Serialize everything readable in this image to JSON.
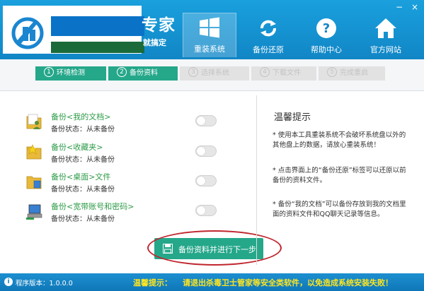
{
  "header": {
    "brand_big": "专家",
    "brand_small": "就搞定",
    "window_controls": [
      "−",
      "×"
    ],
    "nav": [
      {
        "label": "重装系统",
        "icon": "windows-logo-icon",
        "active": true
      },
      {
        "label": "备份还原",
        "icon": "refresh-icon",
        "active": false
      },
      {
        "label": "帮助中心",
        "icon": "question-icon",
        "active": false
      },
      {
        "label": "官方网站",
        "icon": "home-icon",
        "active": false
      }
    ]
  },
  "steps": [
    {
      "num": "1",
      "label": "环境检测",
      "state": "done"
    },
    {
      "num": "2",
      "label": "备份资料",
      "state": "done"
    },
    {
      "num": "3",
      "label": "选择系统",
      "state": "todo"
    },
    {
      "num": "4",
      "label": "下载文件",
      "state": "todo"
    },
    {
      "num": "5",
      "label": "完成重启",
      "state": "todo"
    }
  ],
  "backup_items": [
    {
      "title": "备份<我的文档>",
      "status": "备份状态：从未备份",
      "icon": "my-documents-folder-icon",
      "enabled": false
    },
    {
      "title": "备份<收藏夹>",
      "status": "备份状态：从未备份",
      "icon": "favorites-folder-icon",
      "enabled": false
    },
    {
      "title": "备份<桌面>文件",
      "status": "备份状态：从未备份",
      "icon": "desktop-folder-icon",
      "enabled": false
    },
    {
      "title": "备份<宽带账号和密码>",
      "status": "备份状态：从未备份",
      "icon": "network-computer-icon",
      "enabled": false
    }
  ],
  "tips": {
    "title": "温馨提示",
    "items": [
      "* 使用本工具重装系统不会破坏系统盘以外的其他盘上的数据，请放心重装系统！",
      "* 点击界面上的“备份还原”标签可以还原以前备份的资料文件。",
      "* 备份“我的文档”可以备份存放到我的文档里面的资料文件和QQ聊天记录等信息。"
    ]
  },
  "next_button": {
    "label": "备份资料并进行下一步",
    "icon": "save-disk-icon"
  },
  "footer": {
    "version": "程序版本：1.0.0.0",
    "warning_label": "温馨提示：",
    "warning_text": "请退出杀毒卫士管家等安全类软件，以免造成系统安装失败！"
  },
  "colors": {
    "header_blue": "#1186c6",
    "accent_green": "#25a78a",
    "title_green": "#2c9b47",
    "warning_yellow": "#ffe51f",
    "highlight_red": "#c0262e"
  }
}
